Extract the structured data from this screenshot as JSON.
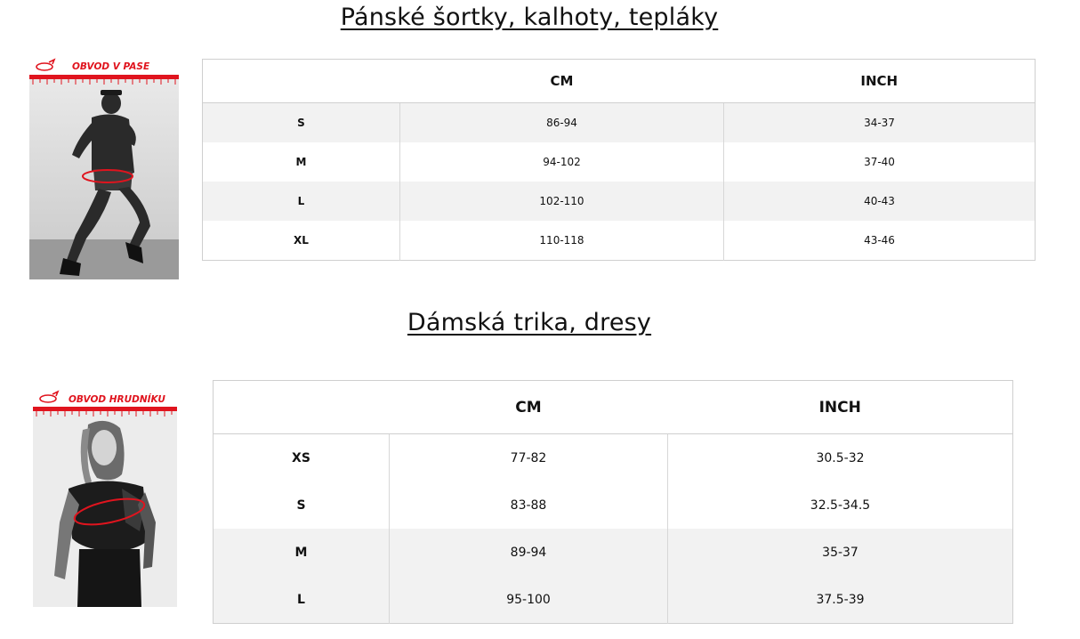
{
  "sections": [
    {
      "title": "Pánské šortky, kalhoty, tepláky",
      "figure_label": "OBVOD V PASE",
      "columns": [
        "",
        "CM",
        "INCH"
      ],
      "rows": [
        {
          "size": "S",
          "cm": "86-94",
          "inch": "34-37"
        },
        {
          "size": "M",
          "cm": "94-102",
          "inch": "37-40"
        },
        {
          "size": "L",
          "cm": "102-110",
          "inch": "40-43"
        },
        {
          "size": "XL",
          "cm": "110-118",
          "inch": "43-46"
        }
      ]
    },
    {
      "title": "Dámská trika, dresy",
      "figure_label": "OBVOD HRUDNÍKU",
      "columns": [
        "",
        "CM",
        "INCH"
      ],
      "rows": [
        {
          "size": "XS",
          "cm": "77-82",
          "inch": "30.5-32"
        },
        {
          "size": "S",
          "cm": "83-88",
          "inch": "32.5-34.5"
        },
        {
          "size": "M",
          "cm": "89-94",
          "inch": "35-37"
        },
        {
          "size": "L",
          "cm": "95-100",
          "inch": "37.5-39"
        }
      ]
    }
  ],
  "colors": {
    "accent_red": "#e0141e",
    "row_shade": "#f2f2f2",
    "border": "#cfcfcf"
  },
  "icons": [
    "measure-tape-icon",
    "measure-tape-icon"
  ]
}
